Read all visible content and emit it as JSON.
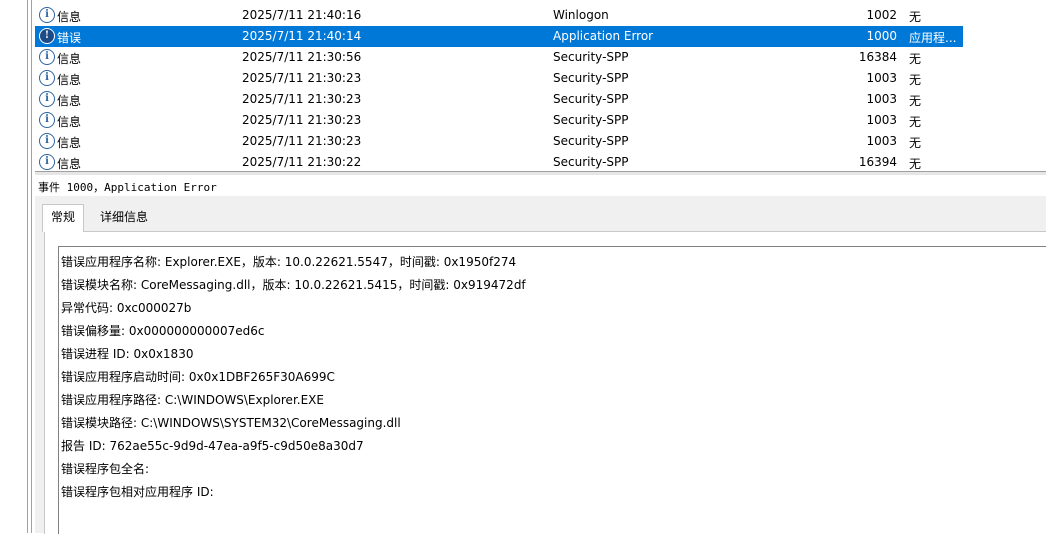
{
  "events": [
    {
      "level": "信息",
      "date": "2025/7/11 21:40:16",
      "source": "Winlogon",
      "id": "1002",
      "task": "无",
      "icon": "info-icon",
      "selected": false
    },
    {
      "level": "错误",
      "date": "2025/7/11 21:40:14",
      "source": "Application Error",
      "id": "1000",
      "task": "应用程...",
      "icon": "error-icon",
      "selected": true
    },
    {
      "level": "信息",
      "date": "2025/7/11 21:30:56",
      "source": "Security-SPP",
      "id": "16384",
      "task": "无",
      "icon": "info-icon",
      "selected": false
    },
    {
      "level": "信息",
      "date": "2025/7/11 21:30:23",
      "source": "Security-SPP",
      "id": "1003",
      "task": "无",
      "icon": "info-icon",
      "selected": false
    },
    {
      "level": "信息",
      "date": "2025/7/11 21:30:23",
      "source": "Security-SPP",
      "id": "1003",
      "task": "无",
      "icon": "info-icon",
      "selected": false
    },
    {
      "level": "信息",
      "date": "2025/7/11 21:30:23",
      "source": "Security-SPP",
      "id": "1003",
      "task": "无",
      "icon": "info-icon",
      "selected": false
    },
    {
      "level": "信息",
      "date": "2025/7/11 21:30:23",
      "source": "Security-SPP",
      "id": "1003",
      "task": "无",
      "icon": "info-icon",
      "selected": false
    },
    {
      "level": "信息",
      "date": "2025/7/11 21:30:22",
      "source": "Security-SPP",
      "id": "16394",
      "task": "无",
      "icon": "info-icon",
      "selected": false
    }
  ],
  "detail": {
    "title": "事件 1000，Application Error",
    "tabs": [
      "常规",
      "详细信息"
    ],
    "lines": [
      "错误应用程序名称: Explorer.EXE，版本: 10.0.22621.5547，时间戳: 0x1950f274",
      "错误模块名称: CoreMessaging.dll，版本: 10.0.22621.5415，时间戳: 0x919472df",
      "异常代码: 0xc000027b",
      "错误偏移量: 0x000000000007ed6c",
      "错误进程 ID: 0x0x1830",
      "错误应用程序启动时间: 0x0x1DBF265F30A699C",
      "错误应用程序路径: C:\\WINDOWS\\Explorer.EXE",
      "错误模块路径: C:\\WINDOWS\\SYSTEM32\\CoreMessaging.dll",
      "报告 ID: 762ae55c-9d9d-47ea-a9f5-c9d50e8a30d7",
      "错误程序包全名:",
      "错误程序包相对应用程序 ID:"
    ]
  },
  "colors": {
    "selection": "#0078d7",
    "info": "#2b64a3"
  }
}
